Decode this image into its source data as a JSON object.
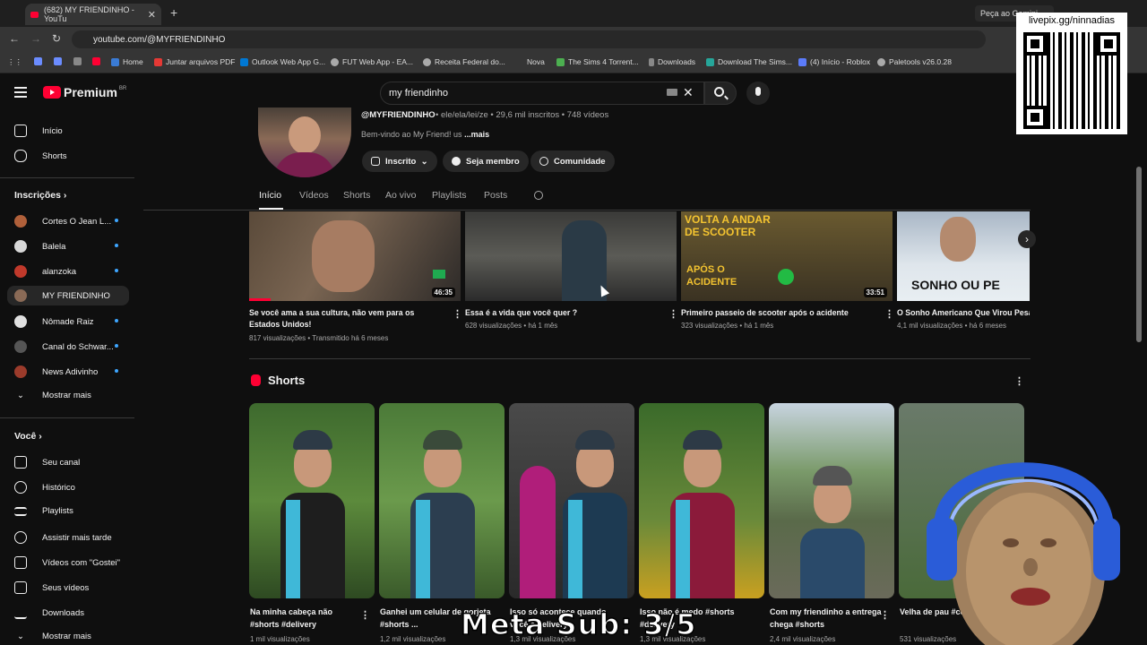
{
  "browser": {
    "tab_title": "(682) MY FRIENDINHO - YouTu",
    "tab_close": "✕",
    "new_tab": "+",
    "gemini_label": "Peça ao Gemini",
    "url": "youtube.com/@MYFRIENDINHO",
    "bookmarks": [
      {
        "label": "Home"
      },
      {
        "label": "Juntar arquivos PDF"
      },
      {
        "label": "Outlook Web App G..."
      },
      {
        "label": "FUT Web App - EA..."
      },
      {
        "label": "Receita Federal do..."
      },
      {
        "label": "Nova"
      },
      {
        "label": "The Sims 4 Torrent..."
      },
      {
        "label": "Downloads"
      },
      {
        "label": "Download The Sims..."
      },
      {
        "label": "(4) Início - Roblox"
      },
      {
        "label": "Paletools v26.0.28"
      }
    ]
  },
  "youtube": {
    "logo_text": "Premium",
    "logo_region": "BR",
    "search_value": "my friendinho",
    "sidebar": {
      "home": "Início",
      "shorts": "Shorts",
      "subscriptions_header": "Inscrições",
      "subscriptions": [
        {
          "label": "Cortes O Jean L...",
          "color": "#b0603a"
        },
        {
          "label": "Balela",
          "color": "#d8d8d8"
        },
        {
          "label": "alanzoka",
          "color": "#c0392b"
        },
        {
          "label": "MY FRIENDINHO",
          "color": "#8a6a56"
        },
        {
          "label": "Nômade Raiz",
          "color": "#e0e0e0"
        },
        {
          "label": "Canal do Schwar...",
          "color": "#333"
        },
        {
          "label": "News Adivinho",
          "color": "#9b3b2b"
        }
      ],
      "show_more": "Mostrar mais",
      "you_header": "Você",
      "you_items": [
        "Seu canal",
        "Histórico",
        "Playlists",
        "Assistir mais tarde",
        "Vídeos com \"Gostei\"",
        "Seus vídeos",
        "Downloads",
        "Mostrar mais"
      ]
    },
    "channel": {
      "handle": "@MYFRIENDINHO",
      "meta": "• ele/ela/lei/ze • 29,6 mil inscritos • 748 vídeos",
      "desc": "Bem-vindo ao My Friend! us",
      "desc_more": "...mais",
      "subscribed": "Inscrito",
      "join": "Seja membro",
      "community": "Comunidade"
    },
    "tabs": [
      "Início",
      "Vídeos",
      "Shorts",
      "Ao vivo",
      "Playlists",
      "Posts"
    ],
    "videos": [
      {
        "title": "Se você ama a sua cultura, não vem para os Estados Unidos!",
        "meta": "817 visualizações • Transmitido há 6 meses",
        "duration": "46:35"
      },
      {
        "title": "Essa é a vida que você quer ?",
        "meta": "628 visualizações • há 1 mês",
        "duration": ""
      },
      {
        "title": "Primeiro passeio de scooter após o acidente",
        "meta": "323 visualizações • há 1 mês",
        "duration": "33:51",
        "overlay_top": "VOLTA A ANDAR DE SCOOTER",
        "overlay_bottom": "APÓS O ACIDENTE"
      },
      {
        "title": "O Sonho Americano Que Virou Pesa",
        "meta": "4,1 mil visualizações • há 6 meses",
        "duration": "",
        "overlay": "SONHO OU PE"
      }
    ],
    "shorts_header": "Shorts",
    "shorts": [
      {
        "title": "Na minha cabeça não #shorts #delivery",
        "meta": "1 mil visualizações"
      },
      {
        "title": "Ganhei um celular de gorjeta #shorts ...",
        "meta": "1,2 mil visualizações"
      },
      {
        "title": "Isso só acontece quando você é delivery",
        "meta": "1,3 mil visualizações"
      },
      {
        "title": "Isso não é medo #shorts #delivery",
        "meta": "1,3 mil visualizações"
      },
      {
        "title": "Com my friendinho a entrega chega #shorts",
        "meta": "2,4 mil visualizações"
      },
      {
        "title": "Velha de pau #comedy",
        "meta": "531 visualizações"
      }
    ]
  },
  "overlay": {
    "qr_label": "livepix.gg/ninnadias",
    "sub_goal": "Meta Sub: 3/5"
  },
  "colors": {
    "accent": "#ff0033",
    "background": "#0f0f0f",
    "link_blue": "#3ea6ff"
  }
}
